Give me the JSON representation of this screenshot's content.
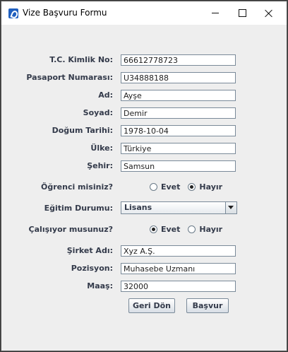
{
  "window": {
    "title": "Vize Başvuru Formu"
  },
  "fields": [
    {
      "label": "T.C. Kimlik No:",
      "value": "66612778723"
    },
    {
      "label": "Pasaport Numarası:",
      "value": "U34888188"
    },
    {
      "label": "Ad:",
      "value": "Ayşe"
    },
    {
      "label": "Soyad:",
      "value": "Demir"
    },
    {
      "label": "Doğum Tarihi:",
      "value": "1978-10-04"
    },
    {
      "label": "Ülke:",
      "value": "Türkiye"
    },
    {
      "label": "Şehir:",
      "value": "Samsun"
    }
  ],
  "student": {
    "label": "Öğrenci misiniz?",
    "options": [
      "Evet",
      "Hayır"
    ],
    "selected": "Hayır"
  },
  "education": {
    "label": "Eğitim Durumu:",
    "selected": "Lisans"
  },
  "working": {
    "label": "Çalışıyor musunuz?",
    "options": [
      "Evet",
      "Hayır"
    ],
    "selected": "Evet"
  },
  "job": [
    {
      "label": "Şirket Adı:",
      "value": "Xyz A.Ş."
    },
    {
      "label": "Pozisyon:",
      "value": "Muhasebe Uzmanı"
    },
    {
      "label": "Maaş:",
      "value": "32000"
    }
  ],
  "buttons": {
    "back": "Geri Dön",
    "apply": "Başvur"
  }
}
